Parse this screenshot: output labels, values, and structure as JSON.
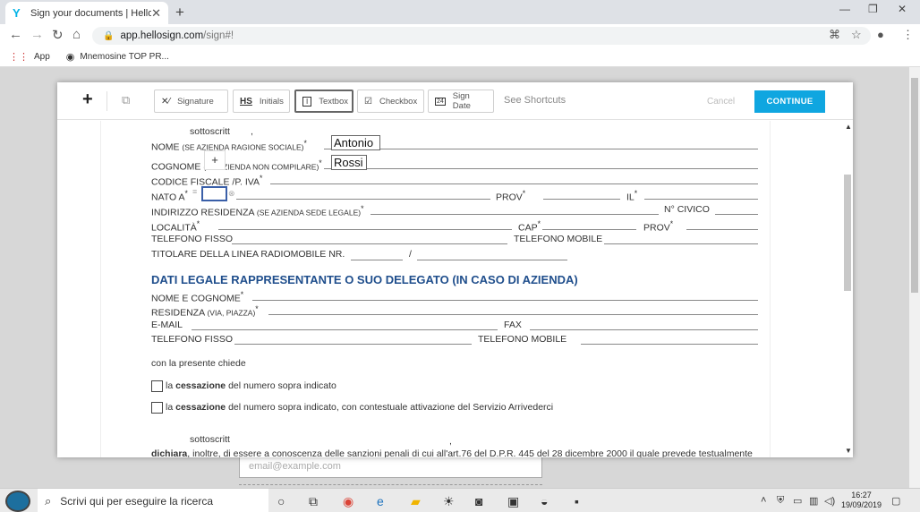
{
  "browser": {
    "tab_title": "Sign your documents | HelloSign",
    "tab_favicon": "Y",
    "tab_close": "✕",
    "new_tab": "+",
    "url_host": "app.hellosign.com",
    "url_path": "/sign#!",
    "bookmarks": [
      {
        "icon": "apps-grid-icon",
        "glyph": "⋮⋮",
        "label": "App"
      },
      {
        "icon": "bookmark-site-icon",
        "glyph": "◉",
        "label": "Mnemosine TOP PR..."
      }
    ]
  },
  "toolbar": {
    "plus": "+",
    "tools": [
      {
        "name": "signature",
        "icon_glyph": "✕⁄",
        "label": "Signature",
        "active": false
      },
      {
        "name": "initials",
        "icon_glyph": "HS",
        "label": "Initials",
        "active": false
      },
      {
        "name": "textbox",
        "icon_glyph": "I",
        "label": "Textbox",
        "active": true
      },
      {
        "name": "checkbox",
        "icon_glyph": "☑",
        "label": "Checkbox",
        "active": false
      },
      {
        "name": "sign-date",
        "icon_glyph": "24",
        "label": "Sign Date",
        "active": false
      }
    ],
    "shortcuts": "See Shortcuts",
    "cancel": "Cancel",
    "continue": "CONTINUE"
  },
  "document": {
    "sottoscritt_top": "sottoscritt",
    "comma": ",",
    "nome": "NOME",
    "nome_note": "(SE AZIENDA RAGIONE SOCIALE)",
    "cognome": "COGNOME",
    "cognome_note": "(SE AZIENDA NON COMPILARE)",
    "codice_fiscale": "CODICE FISCALE /P. IVA",
    "nato_a": "NATO A",
    "prov": "PROV",
    "il": "IL",
    "indirizzo": "INDIRIZZO RESIDENZA",
    "indirizzo_note": "(SE AZIENDA SEDE LEGALE)",
    "n_civico": "N° CIVICO",
    "localita": "LOCALITÀ",
    "cap": "CAP",
    "prov2": "PROV",
    "telefono_fisso": "TELEFONO FISSO",
    "telefono_mobile": "TELEFONO MOBILE",
    "titolare": "TITOLARE DELLA LINEA RADIOMOBILE  NR.",
    "slash": "/",
    "heading": "DATI LEGALE RAPPRESENTANTE O SUO DELEGATO (IN CASO DI AZIENDA)",
    "nome_cognome": "NOME E COGNOME",
    "residenza": "RESIDENZA",
    "residenza_note": "(VIA, PIAZZA)",
    "email": "E-MAIL",
    "fax": "FAX",
    "telefono_fisso2": "TELEFONO FISSO",
    "telefono_mobile2": "TELEFONO MOBILE",
    "chiede": "con la presente chiede",
    "option1_pre": "la",
    "option1_bold": "cessazione",
    "option1_post": "del numero sopra indicato",
    "option2_pre": "la",
    "option2_bold": "cessazione",
    "option2_post": "del numero sopra indicato, con contestuale attivazione del Servizio Arrivederci",
    "sottoscritt_bottom": "sottoscritt",
    "dichiara_bold": "dichiara",
    "dichiara_text": ", inoltre, di essere a conoscenza delle sanzioni penali di cui all'art.76 del D.P.R. 445 del 28 dicembre 2000 il quale prevede testualmente",
    "field_nome_value": "Antonio",
    "field_cognome_value": "Rossi",
    "add_popup": "+",
    "asterisk": "*"
  },
  "background_field": {
    "email_placeholder": "email@example.com"
  },
  "taskbar": {
    "search_placeholder": "Scrivi qui per eseguire la ricerca",
    "time": "16:27",
    "date": "19/09/2019"
  }
}
